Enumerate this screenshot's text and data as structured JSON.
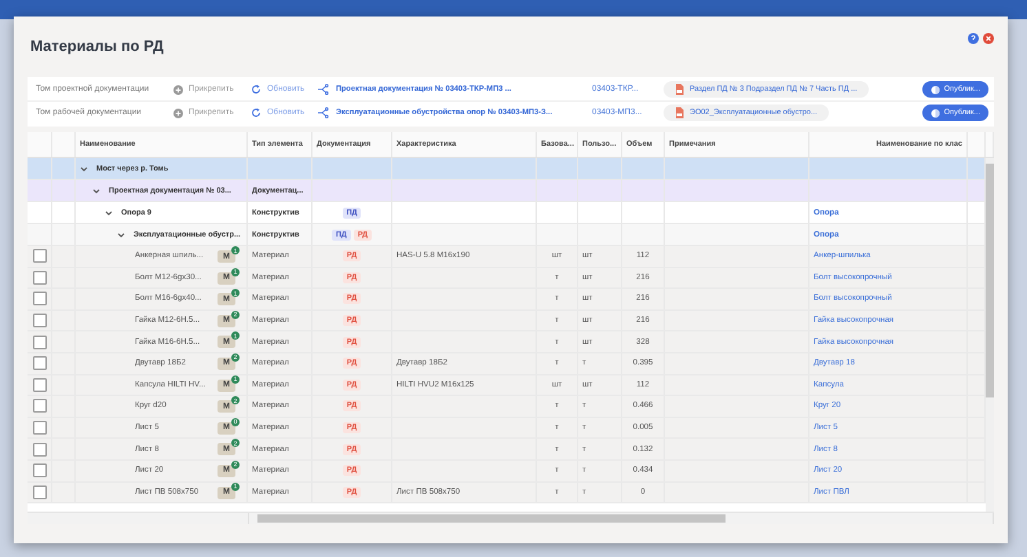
{
  "window": {
    "title": "Материалы по РД"
  },
  "documents": [
    {
      "label": "Том проектной документации",
      "attach": "Прикрепить",
      "refresh": "Обновить",
      "title": "Проектная документация № 03403-ТКР-МП3 ...",
      "code": "03403-ТКР...",
      "file": "Раздел ПД № 3 Подраздел ПД № 7 Часть ПД ...",
      "publish": "Опублик..."
    },
    {
      "label": "Том рабочей документации",
      "attach": "Прикрепить",
      "refresh": "Обновить",
      "title": "Эксплуатационные обустройства опор № 03403-МП3-З...",
      "code": "03403-МП3...",
      "file": "ЭО02_Эксплуатационные обустро...",
      "publish": "Опублик..."
    }
  ],
  "table": {
    "columns": [
      "Наименование",
      "Тип элемента",
      "Документация",
      "Характеристика",
      "Базова...",
      "Пользо...",
      "Объем",
      "Примечания",
      "Наименование по клас"
    ],
    "rows": [
      {
        "kind": "group",
        "name": "Мост через р. Томь",
        "expanded": true,
        "children": [
          {
            "kind": "group",
            "name": "Проектная документация № 03...",
            "type": "Документац...",
            "expanded": true,
            "children": [
              {
                "kind": "group",
                "name": "Опора 9",
                "type": "Конструктив",
                "docs": [
                  {
                    "kind": "pd",
                    "label": "ПД"
                  }
                ],
                "class_name": "Опора",
                "expanded": true,
                "children": [
                  {
                    "kind": "group",
                    "name": "Эксплуатационные обустр...",
                    "type": "Конструктив",
                    "docs": [
                      {
                        "kind": "pd",
                        "label": "ПД"
                      },
                      {
                        "kind": "rd",
                        "label": "РД"
                      }
                    ],
                    "class_name": "Опора",
                    "expanded": true,
                    "children": [
                      {
                        "kind": "material",
                        "checked": false,
                        "name": "Анкерная шпиль...",
                        "badge": "М",
                        "badge_count": "1",
                        "type": "Материал",
                        "docs": [
                          {
                            "kind": "rd",
                            "label": "РД"
                          }
                        ],
                        "characteristic": "HAS-U 5.8 M16x190",
                        "base_unit": "шт",
                        "user_unit": "шт",
                        "volume": "112",
                        "class_name": "Анкер-шпилька"
                      },
                      {
                        "kind": "material",
                        "checked": false,
                        "name": "Болт М12-6gx30...",
                        "badge": "М",
                        "badge_count": "1",
                        "type": "Материал",
                        "docs": [
                          {
                            "kind": "rd",
                            "label": "РД"
                          }
                        ],
                        "base_unit": "т",
                        "user_unit": "шт",
                        "volume": "216",
                        "class_name": "Болт высокопрочный"
                      },
                      {
                        "kind": "material",
                        "checked": false,
                        "name": "Болт М16-6gx40...",
                        "badge": "М",
                        "badge_count": "1",
                        "type": "Материал",
                        "docs": [
                          {
                            "kind": "rd",
                            "label": "РД"
                          }
                        ],
                        "base_unit": "т",
                        "user_unit": "шт",
                        "volume": "216",
                        "class_name": "Болт высокопрочный"
                      },
                      {
                        "kind": "material",
                        "checked": false,
                        "name": "Гайка М12-6Н.5...",
                        "badge": "М",
                        "badge_count": "2",
                        "type": "Материал",
                        "docs": [
                          {
                            "kind": "rd",
                            "label": "РД"
                          }
                        ],
                        "base_unit": "т",
                        "user_unit": "шт",
                        "volume": "216",
                        "class_name": "Гайка высокопрочная"
                      },
                      {
                        "kind": "material",
                        "checked": false,
                        "name": "Гайка М16-6Н.5...",
                        "badge": "М",
                        "badge_count": "1",
                        "type": "Материал",
                        "docs": [
                          {
                            "kind": "rd",
                            "label": "РД"
                          }
                        ],
                        "base_unit": "т",
                        "user_unit": "шт",
                        "volume": "328",
                        "class_name": "Гайка высокопрочная"
                      },
                      {
                        "kind": "material",
                        "checked": false,
                        "name": "Двутавр 18Б2",
                        "badge": "М",
                        "badge_count": "2",
                        "type": "Материал",
                        "docs": [
                          {
                            "kind": "rd",
                            "label": "РД"
                          }
                        ],
                        "characteristic": "Двутавр 18Б2",
                        "base_unit": "т",
                        "user_unit": "т",
                        "volume": "0.395",
                        "class_name": "Двутавр 18"
                      },
                      {
                        "kind": "material",
                        "checked": false,
                        "name": "Капсула HILTI HV...",
                        "badge": "М",
                        "badge_count": "1",
                        "type": "Материал",
                        "docs": [
                          {
                            "kind": "rd",
                            "label": "РД"
                          }
                        ],
                        "characteristic": "HILTI HVU2 M16x125",
                        "base_unit": "шт",
                        "user_unit": "шт",
                        "volume": "112",
                        "class_name": "Капсула"
                      },
                      {
                        "kind": "material",
                        "checked": false,
                        "name": "Круг d20",
                        "badge": "М",
                        "badge_count": "2",
                        "type": "Материал",
                        "docs": [
                          {
                            "kind": "rd",
                            "label": "РД"
                          }
                        ],
                        "base_unit": "т",
                        "user_unit": "т",
                        "volume": "0.466",
                        "class_name": "Круг 20"
                      },
                      {
                        "kind": "material",
                        "checked": false,
                        "name": "Лист 5",
                        "badge": "М",
                        "badge_count": "0",
                        "type": "Материал",
                        "docs": [
                          {
                            "kind": "rd",
                            "label": "РД"
                          }
                        ],
                        "base_unit": "т",
                        "user_unit": "т",
                        "volume": "0.005",
                        "class_name": "Лист 5"
                      },
                      {
                        "kind": "material",
                        "checked": false,
                        "name": "Лист 8",
                        "badge": "М",
                        "badge_count": "2",
                        "type": "Материал",
                        "docs": [
                          {
                            "kind": "rd",
                            "label": "РД"
                          }
                        ],
                        "base_unit": "т",
                        "user_unit": "т",
                        "volume": "0.132",
                        "class_name": "Лист 8"
                      },
                      {
                        "kind": "material",
                        "checked": false,
                        "name": "Лист 20",
                        "badge": "М",
                        "badge_count": "2",
                        "type": "Материал",
                        "docs": [
                          {
                            "kind": "rd",
                            "label": "РД"
                          }
                        ],
                        "base_unit": "т",
                        "user_unit": "т",
                        "volume": "0.434",
                        "class_name": "Лист 20"
                      },
                      {
                        "kind": "material",
                        "checked": false,
                        "name": "Лист ПВ 508x750",
                        "badge": "М",
                        "badge_count": "1",
                        "type": "Материал",
                        "docs": [
                          {
                            "kind": "rd",
                            "label": "РД"
                          }
                        ],
                        "characteristic": "Лист ПВ 508x750",
                        "base_unit": "т",
                        "user_unit": "т",
                        "volume": "0",
                        "class_name": "Лист ПВЛ"
                      }
                    ]
                  }
                ]
              }
            ]
          }
        ]
      }
    ]
  }
}
